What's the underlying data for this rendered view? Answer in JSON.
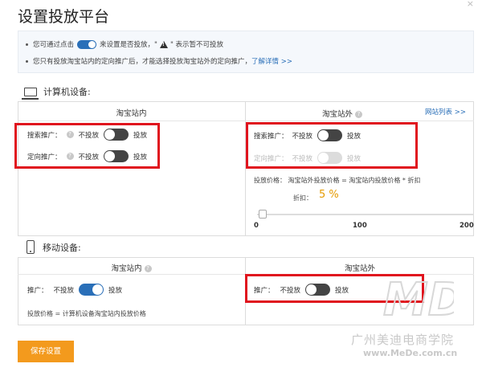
{
  "page": {
    "title": "设置投放平台",
    "close": "×"
  },
  "notice": {
    "line1_pre": "您可通过点击",
    "line1_mid": "来设置是否投放，\"",
    "line1_post": "\" 表示暂不可投放",
    "line2_pre": "您只有投放淘宝站内的定向推广后，才能选择投放淘宝站外的定向推广，",
    "line2_link": "了解详情 >>"
  },
  "computer": {
    "heading": "计算机设备:",
    "col_in": "淘宝站内",
    "col_out": "淘宝站外",
    "site_list_link": "网站列表 >>",
    "in_rows": [
      {
        "label": "搜索推广：",
        "off": "不投放",
        "on": "投放"
      },
      {
        "label": "定向推广：",
        "off": "不投放",
        "on": "投放"
      }
    ],
    "out_rows": [
      {
        "label": "搜索推广：",
        "off": "不投放",
        "on": "投放"
      },
      {
        "label": "定向推广：",
        "off": "不投放",
        "on": "投放"
      }
    ],
    "price_formula": "投放价格：  淘宝站外投放价格 = 淘宝站内投放价格 * 折扣",
    "discount_label": "折扣：",
    "discount_value": "5 %",
    "slider": {
      "value": 5,
      "min": 0,
      "max": 200,
      "ticks": [
        "0",
        "100",
        "200"
      ]
    }
  },
  "mobile": {
    "heading": "移动设备:",
    "col_in": "淘宝站内",
    "col_out": "淘宝站外",
    "in_row": {
      "label": "推广：",
      "off": "不投放",
      "on": "投放"
    },
    "out_row": {
      "label": "推广：",
      "off": "不投放",
      "on": "投放"
    },
    "price_formula": "投放价格  =  计算机设备淘宝站内投放价格"
  },
  "save_button": "保存设置",
  "watermark": {
    "logo": "MD",
    "text": "广州美迪电商学院",
    "url": "www.MeDe.com.cn"
  },
  "colors": {
    "accent": "#2a6fb8",
    "save": "#f39a1d",
    "highlight": "#e0141e"
  }
}
